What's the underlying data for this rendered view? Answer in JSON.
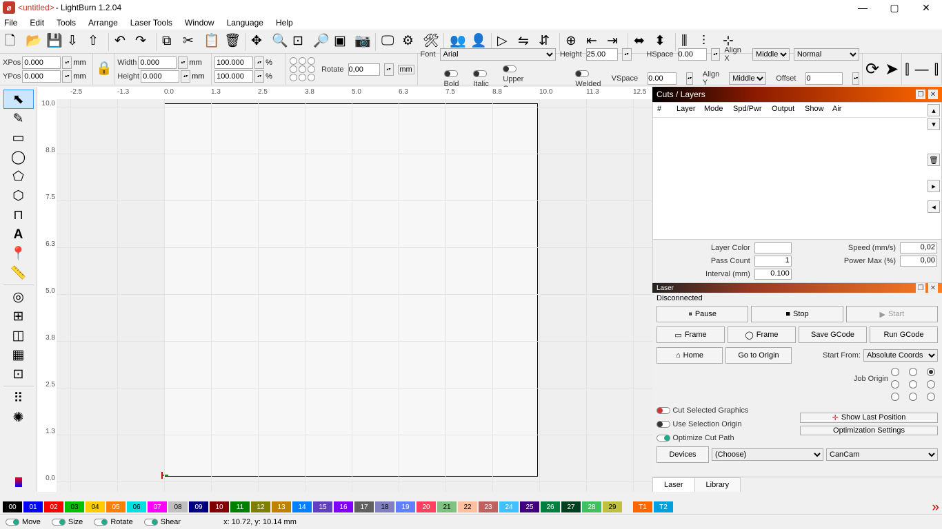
{
  "title": {
    "untitled": "<untitled>",
    "app": " - LightBurn 1.2.04"
  },
  "menu": [
    "File",
    "Edit",
    "Tools",
    "Arrange",
    "Laser Tools",
    "Window",
    "Language",
    "Help"
  ],
  "props": {
    "xpos_label": "XPos",
    "xpos": "0.000",
    "ypos_label": "YPos",
    "ypos": "0.000",
    "width_label": "Width",
    "width": "0.000",
    "height_label": "Height",
    "height": "0.000",
    "mm": "mm",
    "pct": "%",
    "scale1": "100.000",
    "scale2": "100.000",
    "rotate_label": "Rotate",
    "rotate": "0,00",
    "font_label": "Font",
    "font": "Arial",
    "fheight_label": "Height",
    "fheight": "25.00",
    "hspace_label": "HSpace",
    "hspace": "0.00",
    "vspace_label": "VSpace",
    "vspace": "0.00",
    "alignx_label": "Align X",
    "alignx": "Middle",
    "aligny_label": "Align Y",
    "aligny": "Middle",
    "normal": "Normal",
    "offset_label": "Offset",
    "offset": "0",
    "bold": "Bold",
    "italic": "Italic",
    "upper": "Upper Case",
    "welded": "Welded"
  },
  "ruler_ticks": [
    "-2.5",
    "-1.3",
    "0.0",
    "1.3",
    "2.5",
    "3.8",
    "5.0",
    "6.3",
    "7.5",
    "8.8",
    "10.0",
    "11.3",
    "12.5"
  ],
  "ruler_v": [
    "0.0",
    "1.3",
    "2.5",
    "3.8",
    "5.0",
    "6.3",
    "7.5",
    "8.8",
    "10.0"
  ],
  "cuts": {
    "title": "Cuts / Layers",
    "cols": [
      "#",
      "Layer",
      "Mode",
      "Spd/Pwr",
      "Output",
      "Show",
      "Air"
    ],
    "layercolor": "Layer Color",
    "speed": "Speed (mm/s)",
    "speed_v": "0,02",
    "passcount": "Pass Count",
    "passcount_v": "1",
    "powermax": "Power Max (%)",
    "powermax_v": "0,00",
    "interval": "Interval (mm)",
    "interval_v": "0.100"
  },
  "laser": {
    "title": "Laser",
    "status": "Disconnected",
    "pause": "Pause",
    "stop": "Stop",
    "start": "Start",
    "frame": "Frame",
    "savegcode": "Save GCode",
    "rungcode": "Run GCode",
    "home": "Home",
    "gotoorigin": "Go to Origin",
    "startfrom": "Start From:",
    "startfrom_v": "Absolute Coords",
    "joborigin": "Job Origin",
    "cutsel": "Cut Selected Graphics",
    "usesel": "Use Selection Origin",
    "opt": "Optimize Cut Path",
    "showlast": "Show Last Position",
    "optset": "Optimization Settings",
    "devices": "Devices",
    "choose": "(Choose)",
    "cancam": "CanCam",
    "tab_laser": "Laser",
    "tab_library": "Library"
  },
  "palette": [
    {
      "c": "#000000",
      "t": "00"
    },
    {
      "c": "#0000ff",
      "t": "01"
    },
    {
      "c": "#ff0000",
      "t": "02"
    },
    {
      "c": "#00c000",
      "t": "03",
      "lt": true
    },
    {
      "c": "#ffcc00",
      "t": "04",
      "lt": true
    },
    {
      "c": "#ff8000",
      "t": "05"
    },
    {
      "c": "#00e0e0",
      "t": "06",
      "lt": true
    },
    {
      "c": "#ff00ff",
      "t": "07"
    },
    {
      "c": "#c0c0c0",
      "t": "08",
      "lt": true
    },
    {
      "c": "#000080",
      "t": "09"
    },
    {
      "c": "#800000",
      "t": "10"
    },
    {
      "c": "#008000",
      "t": "11"
    },
    {
      "c": "#808000",
      "t": "12"
    },
    {
      "c": "#c08000",
      "t": "13"
    },
    {
      "c": "#0080ff",
      "t": "14"
    },
    {
      "c": "#6040c0",
      "t": "15"
    },
    {
      "c": "#8000ff",
      "t": "16"
    },
    {
      "c": "#606060",
      "t": "17"
    },
    {
      "c": "#8080c0",
      "t": "18",
      "lt": true
    },
    {
      "c": "#6080ff",
      "t": "19"
    },
    {
      "c": "#ff4060",
      "t": "20"
    },
    {
      "c": "#80c080",
      "t": "21",
      "lt": true
    },
    {
      "c": "#ffc0a0",
      "t": "22",
      "lt": true
    },
    {
      "c": "#c06060",
      "t": "23"
    },
    {
      "c": "#40c0ff",
      "t": "24"
    },
    {
      "c": "#400080",
      "t": "25"
    },
    {
      "c": "#008040",
      "t": "26"
    },
    {
      "c": "#004020",
      "t": "27"
    },
    {
      "c": "#40c060",
      "t": "28"
    },
    {
      "c": "#c0c040",
      "t": "29",
      "lt": true
    }
  ],
  "palette_t": [
    {
      "c": "#ff6600",
      "t": "T1"
    },
    {
      "c": "#00a0e0",
      "t": "T2"
    }
  ],
  "status": {
    "move": "Move",
    "size": "Size",
    "rotate": "Rotate",
    "shear": "Shear",
    "coords": "x: 10.72, y: 10.14 mm"
  }
}
